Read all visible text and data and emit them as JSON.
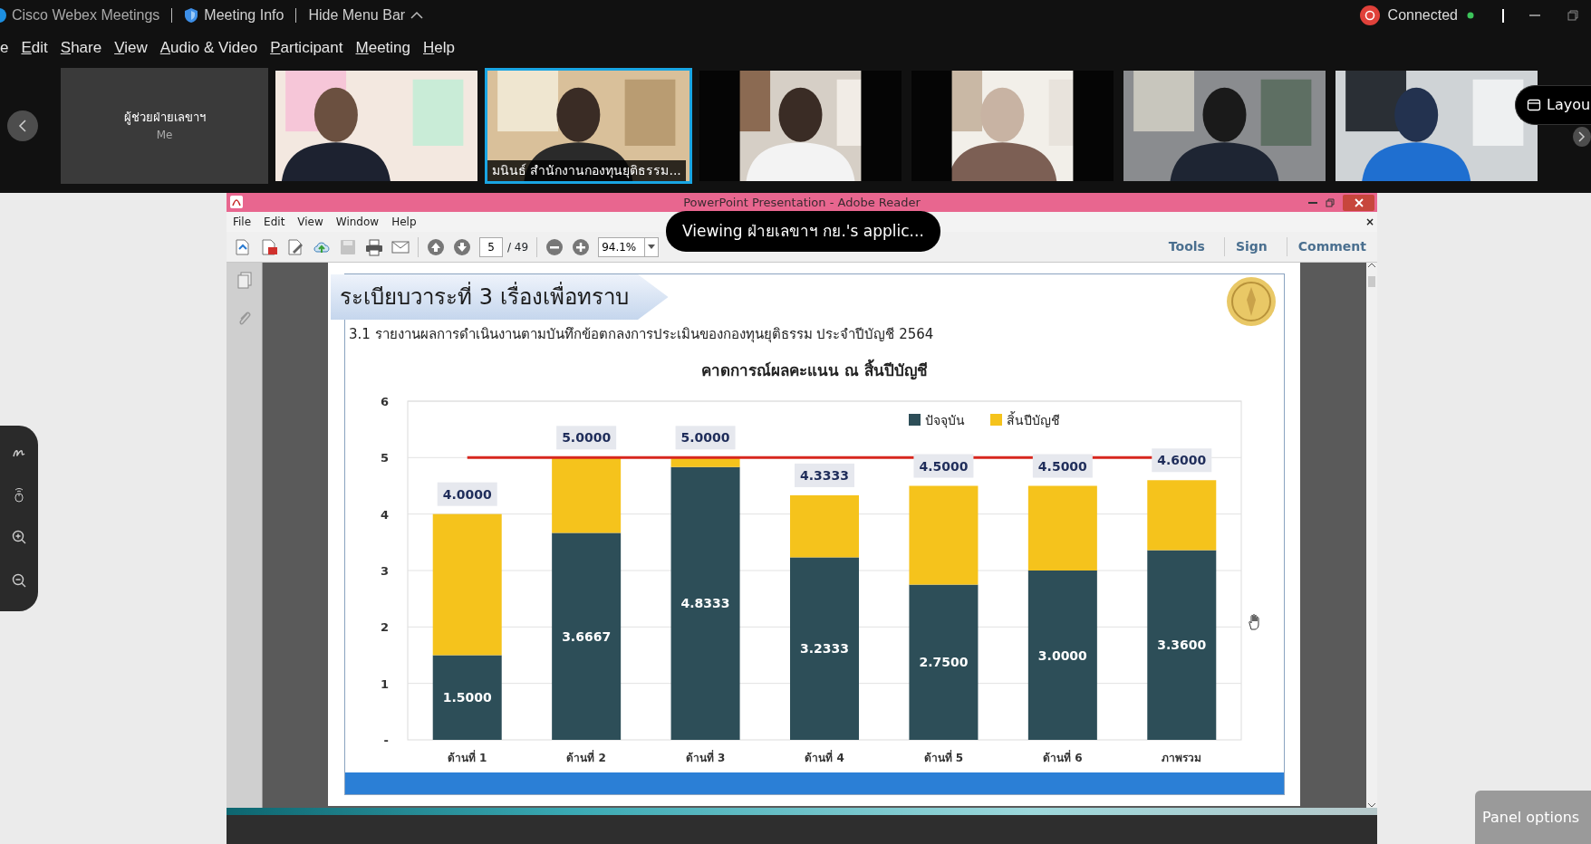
{
  "webex": {
    "title_items": [
      {
        "kind": "app",
        "label": "Cisco Webex Meetings"
      },
      {
        "kind": "info",
        "label": "Meeting Info"
      },
      {
        "kind": "toggle",
        "label": "Hide Menu Bar"
      }
    ],
    "status": "Connected",
    "menu": [
      {
        "label": "e",
        "mnemonic": false
      },
      {
        "label": "Edit",
        "mnemonic": true
      },
      {
        "label": "Share",
        "mnemonic": true
      },
      {
        "label": "View",
        "mnemonic": true
      },
      {
        "label": "Audio & Video",
        "mnemonic": true
      },
      {
        "label": "Participant",
        "mnemonic": true
      },
      {
        "label": "Meeting",
        "mnemonic": true
      },
      {
        "label": "Help",
        "mnemonic": true
      }
    ],
    "participants": [
      {
        "kind": "self",
        "name": "ผู้ช่วยฝ่ายเลขาฯ",
        "subtitle": "Me",
        "selected": false
      },
      {
        "kind": "video",
        "selected": false
      },
      {
        "kind": "video",
        "selected": true,
        "name": "มนินธ์ สำนักงานกองทุนยุติธรรม..."
      },
      {
        "kind": "video",
        "selected": false
      },
      {
        "kind": "video",
        "selected": false
      },
      {
        "kind": "video",
        "selected": false
      },
      {
        "kind": "video",
        "selected": false
      }
    ],
    "layout_button": "Layou",
    "annotation_tools": [
      {
        "kind": "draw"
      },
      {
        "kind": "pointer"
      },
      {
        "kind": "zoom_in"
      },
      {
        "kind": "zoom_out"
      }
    ],
    "share_banner": "Viewing ฝ่ายเลขาฯ กย.'s applic...",
    "panel_options": "Panel options"
  },
  "reader": {
    "title": "PowerPoint Presentation - Adobe Reader",
    "menu": [
      "File",
      "Edit",
      "View",
      "Window",
      "Help"
    ],
    "close_doc": "×",
    "tools": [
      {
        "kind": "open",
        "disabled": false
      },
      {
        "kind": "create",
        "disabled": false
      },
      {
        "kind": "edit",
        "disabled": false
      },
      {
        "kind": "upload",
        "disabled": false
      },
      {
        "kind": "save",
        "disabled": true
      },
      {
        "kind": "print",
        "disabled": false
      },
      {
        "kind": "email",
        "disabled": false
      }
    ],
    "page": "5",
    "page_count": "/ 49",
    "zoom": "94.1%",
    "links": [
      "Tools",
      "Sign",
      "Comment"
    ]
  },
  "slide": {
    "title": "ระเบียบวาระที่ 3 เรื่องเพื่อทราบ",
    "subtitle": "3.1 รายงานผลการดำเนินงานตามบันทึกข้อตกลงการประเมินของกองทุนยุติธรรม ประจำปีบัญชี 2564",
    "chart_data": {
      "type": "bar",
      "title": "คาดการณ์ผลคะแนน ณ สิ้นปีบัญชี",
      "stacked": true,
      "categories": [
        "ด้านที่ 1",
        "ด้านที่ 2",
        "ด้านที่ 3",
        "ด้านที่ 4",
        "ด้านที่ 5",
        "ด้านที่ 6",
        "ภาพรวม"
      ],
      "series": [
        {
          "name": "ปัจจุบัน",
          "color": "#2d4e58",
          "values": [
            1.5,
            3.6667,
            4.8333,
            3.2333,
            2.75,
            3.0,
            3.36
          ],
          "value_labels": [
            "1.5000",
            "3.6667",
            "4.8333",
            "3.2333",
            "2.7500",
            "3.0000",
            "3.3600"
          ]
        },
        {
          "name": "สิ้นปีบัญชี",
          "color": "#f5c31c",
          "values": [
            2.5,
            1.3333,
            0.1667,
            1.1,
            1.75,
            1.5,
            1.24
          ]
        }
      ],
      "ylim": [
        0,
        6
      ],
      "yticks": [
        {
          "value": 0,
          "label": "-"
        },
        1,
        2,
        3,
        4,
        5,
        6
      ],
      "grid": true,
      "legend": "top right",
      "ref_lines": [
        {
          "axis": "y",
          "value": 5,
          "color": "#d7261e"
        }
      ],
      "annotations": [
        {
          "y": 4,
          "text": "4.0000"
        },
        {
          "y": 5,
          "text": "5.0000"
        },
        {
          "y": 5,
          "text": "5.0000"
        },
        {
          "y": 4.3333,
          "text": "4.3333"
        },
        {
          "y": 4.5,
          "text": "4.5000"
        },
        {
          "y": 4.5,
          "text": "4.5000"
        },
        {
          "y": 4.6,
          "text": "4.6000"
        }
      ]
    }
  }
}
